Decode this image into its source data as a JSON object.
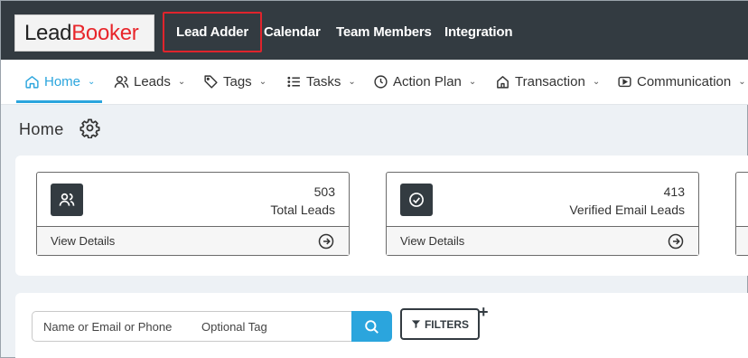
{
  "topbar": {
    "logo": {
      "part1": "Lead",
      "part2": "Booker"
    },
    "nav": [
      "Lead Adder",
      "Calendar",
      "Team Members",
      "Integration"
    ]
  },
  "subnav": {
    "items": [
      {
        "label": "Home",
        "icon": "home-icon"
      },
      {
        "label": "Leads",
        "icon": "users-icon"
      },
      {
        "label": "Tags",
        "icon": "tag-icon"
      },
      {
        "label": "Tasks",
        "icon": "list-icon"
      },
      {
        "label": "Action Plan",
        "icon": "clock-icon"
      },
      {
        "label": "Transaction",
        "icon": "house-icon"
      },
      {
        "label": "Communication",
        "icon": "video-icon"
      }
    ]
  },
  "page": {
    "title": "Home"
  },
  "stats": [
    {
      "value": "503",
      "label": "Total Leads",
      "link": "View Details",
      "icon": "users-icon"
    },
    {
      "value": "413",
      "label": "Verified Email Leads",
      "link": "View Details",
      "icon": "check-circle-icon"
    }
  ],
  "search": {
    "name_placeholder": "Name or Email or Phone",
    "tag_placeholder": "Optional Tag",
    "filters_label": "FILTERS",
    "plus": "+"
  },
  "colors": {
    "topbar": "#333b41",
    "accent": "#2ba5dd",
    "highlight": "#e0242c",
    "brand_red": "#e8262b"
  }
}
